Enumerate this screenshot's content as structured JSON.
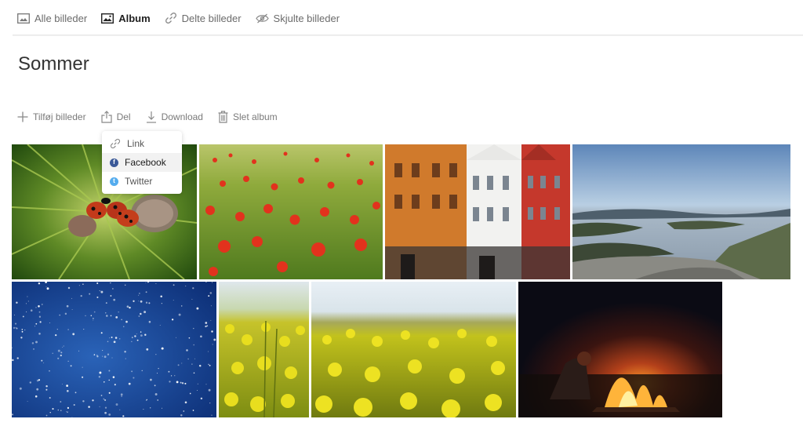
{
  "nav": {
    "items": [
      {
        "label": "Alle billeder",
        "icon": "photo-icon"
      },
      {
        "label": "Album",
        "icon": "album-icon",
        "active": true
      },
      {
        "label": "Delte billeder",
        "icon": "link-icon"
      },
      {
        "label": "Skjulte billeder",
        "icon": "eye-off-icon"
      }
    ]
  },
  "album": {
    "title": "Sommer"
  },
  "toolbar": {
    "add_label": "Tilføj billeder",
    "share_label": "Del",
    "download_label": "Download",
    "delete_label": "Slet album"
  },
  "share_menu": {
    "items": [
      {
        "label": "Link",
        "icon": "link-icon"
      },
      {
        "label": "Facebook",
        "icon": "facebook-icon"
      },
      {
        "label": "Twitter",
        "icon": "twitter-icon"
      }
    ]
  },
  "colors": {
    "facebook": "#3b5998",
    "twitter": "#55acee",
    "active_nav": "#1f1f1f",
    "muted_text": "#7a7a7a"
  },
  "photos": [
    {
      "subject": "ladybugs on pine",
      "icon": "photo-ladybugs"
    },
    {
      "subject": "poppy field",
      "icon": "photo-poppies"
    },
    {
      "subject": "wooden houses",
      "icon": "photo-houses"
    },
    {
      "subject": "fjord landscape",
      "icon": "photo-fjord"
    },
    {
      "subject": "starry sky",
      "icon": "photo-stars"
    },
    {
      "subject": "rapeseed close",
      "icon": "photo-rapeseed-1"
    },
    {
      "subject": "rapeseed field",
      "icon": "photo-rapeseed-2"
    },
    {
      "subject": "campfire at night",
      "icon": "photo-campfire"
    }
  ]
}
